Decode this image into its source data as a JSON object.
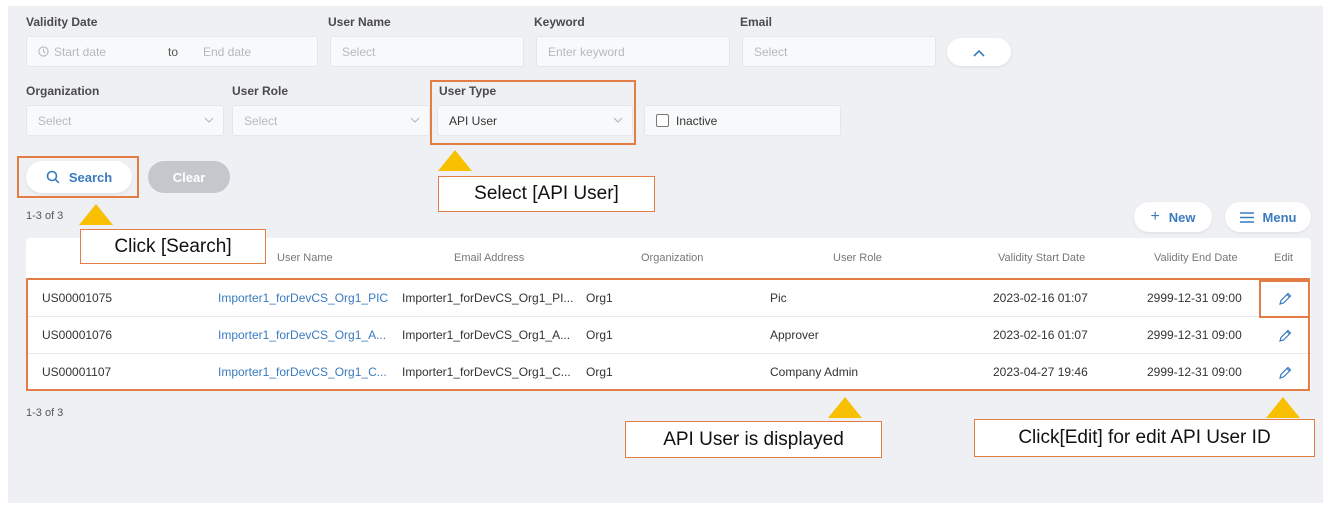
{
  "filters": {
    "validity_date": {
      "label": "Validity Date",
      "start_placeholder": "Start date",
      "to": "to",
      "end_placeholder": "End date"
    },
    "user_name": {
      "label": "User Name",
      "placeholder": "Select"
    },
    "keyword": {
      "label": "Keyword",
      "placeholder": "Enter keyword"
    },
    "email": {
      "label": "Email",
      "placeholder": "Select"
    },
    "organization": {
      "label": "Organization",
      "placeholder": "Select"
    },
    "user_role": {
      "label": "User Role",
      "placeholder": "Select"
    },
    "user_type": {
      "label": "User Type",
      "value": "API User"
    },
    "inactive": {
      "label": "Inactive",
      "checked": false
    }
  },
  "actions": {
    "search": "Search",
    "clear": "Clear",
    "new": "New",
    "menu": "Menu"
  },
  "result_count_top": "1-3 of 3",
  "result_count_bottom": "1-3 of 3",
  "table": {
    "columns": [
      "User Name",
      "Email Address",
      "Organization",
      "User Role",
      "Validity Start Date",
      "Validity End Date",
      "Edit"
    ],
    "rows": [
      {
        "id": "US00001075",
        "user_name": "Importer1_forDevCS_Org1_PIC",
        "email": "Importer1_forDevCS_Org1_PI...",
        "organization": "Org1",
        "role": "Pic",
        "start": "2023-02-16 01:07",
        "end": "2999-12-31 09:00"
      },
      {
        "id": "US00001076",
        "user_name": "Importer1_forDevCS_Org1_A...",
        "email": "Importer1_forDevCS_Org1_A...",
        "organization": "Org1",
        "role": "Approver",
        "start": "2023-02-16 01:07",
        "end": "2999-12-31 09:00"
      },
      {
        "id": "US00001107",
        "user_name": "Importer1_forDevCS_Org1_C...",
        "email": "Importer1_forDevCS_Org1_C...",
        "organization": "Org1",
        "role": "Company Admin",
        "start": "2023-04-27 19:46",
        "end": "2999-12-31 09:00"
      }
    ]
  },
  "callouts": {
    "select_api_user": "Select [API User]",
    "click_search": "Click [Search]",
    "api_user_displayed": "API User is displayed",
    "click_edit": "Click[Edit] for edit API User ID"
  },
  "colors": {
    "highlight": "#e37d45",
    "marker": "#f8c000",
    "link": "#3a7bbf"
  }
}
